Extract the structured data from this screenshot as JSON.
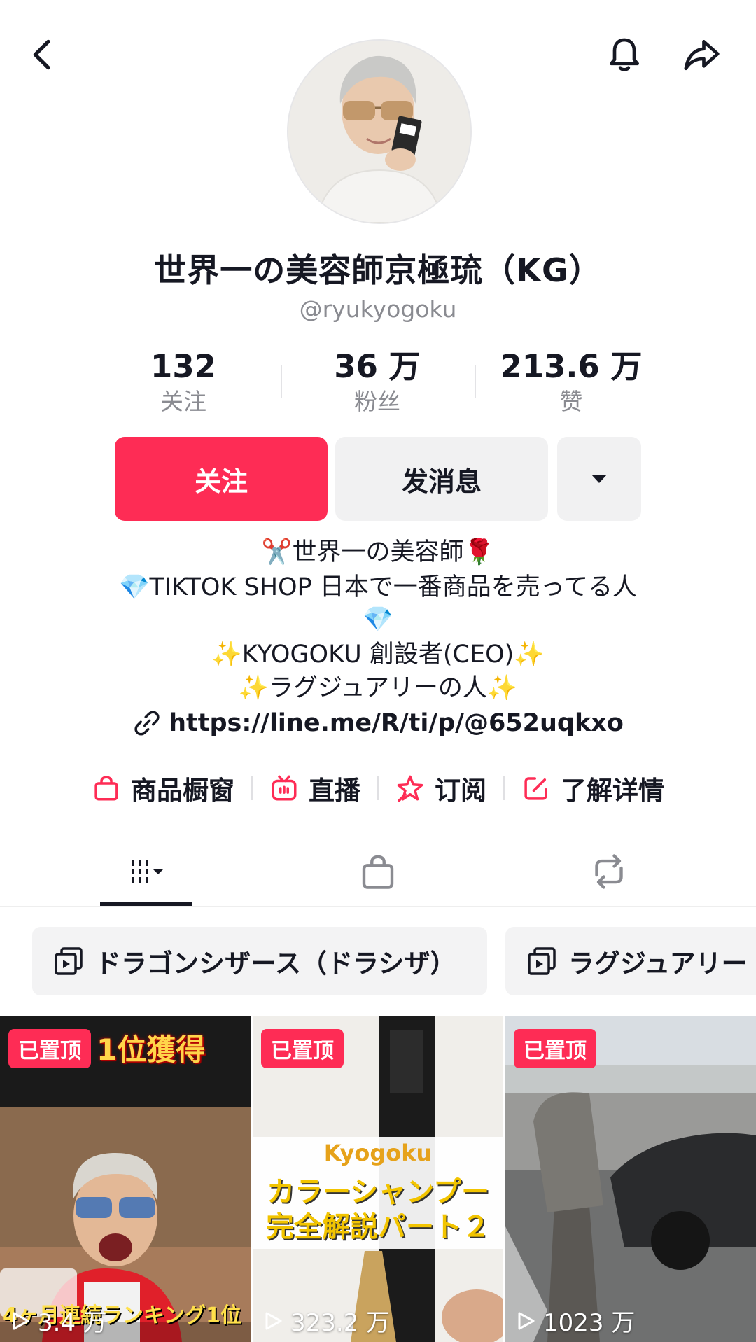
{
  "profile": {
    "display_name": "世界一の美容師京極琉（KG）",
    "handle": "@ryukyogoku"
  },
  "stats": [
    {
      "value": "132",
      "label": "关注"
    },
    {
      "value": "36 万",
      "label": "粉丝"
    },
    {
      "value": "213.6 万",
      "label": "赞"
    }
  ],
  "buttons": {
    "follow": "关注",
    "message": "发消息"
  },
  "bio": {
    "line1": "✂️世界一の美容師🌹",
    "line2": "💎TIKTOK SHOP 日本で一番商品を売ってる人",
    "line3": "💎",
    "line4": "✨KYOGOKU 創設者(CEO)✨",
    "line5": "✨ラグジュアリーの人✨",
    "link": "https://line.me/R/ti/p/@652uqkxo"
  },
  "actions": [
    {
      "label": "商品橱窗",
      "icon": "shopping-bag-icon"
    },
    {
      "label": "直播",
      "icon": "live-tv-icon"
    },
    {
      "label": "订阅",
      "icon": "subscribe-star-icon"
    },
    {
      "label": "了解详情",
      "icon": "edit-info-icon"
    }
  ],
  "tabs": [
    {
      "name": "videos",
      "icon": "grid-icon"
    },
    {
      "name": "shop",
      "icon": "bag-icon"
    },
    {
      "name": "reposts",
      "icon": "repost-icon"
    }
  ],
  "playlists": [
    {
      "label": "ドラゴンシザース（ドラシザ）"
    },
    {
      "label": "ラグジュアリー"
    }
  ],
  "videos": [
    {
      "pinned": "已置顶",
      "views": "3.4 万",
      "title": "1位獲得",
      "caption": "4ヶ月連続ランキング1位"
    },
    {
      "pinned": "已置顶",
      "views": "323.2 万",
      "brand": "Kyogoku",
      "title1": "カラーシャンプー",
      "title2": "完全解説パート２"
    },
    {
      "pinned": "已置顶",
      "views": "1023 万"
    }
  ],
  "colors": {
    "accent": "#fe2c55",
    "text": "#161823",
    "secondary": "#8a8b91",
    "button_bg": "#f1f1f2"
  }
}
